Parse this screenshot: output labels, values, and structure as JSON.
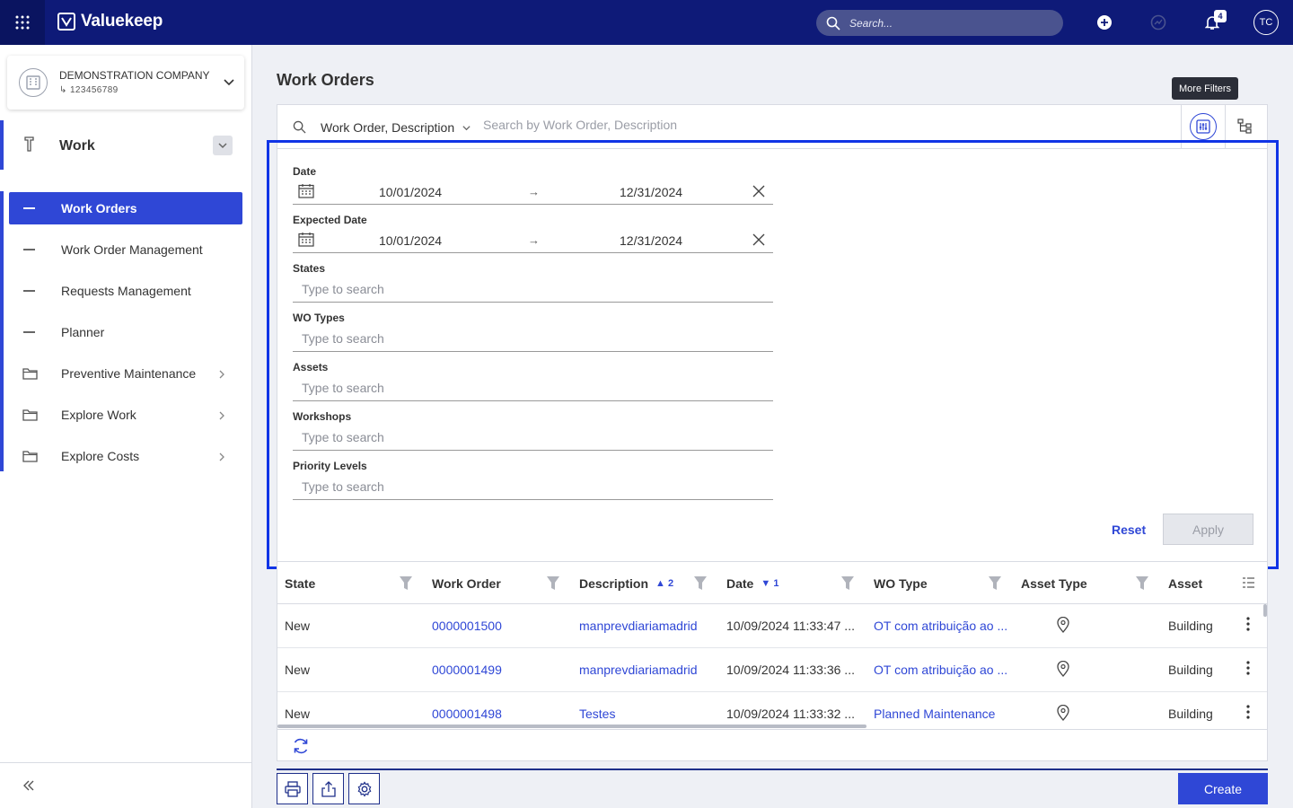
{
  "app": {
    "name": "Valuekeep",
    "search_placeholder": "Search...",
    "notification_count": "4",
    "user_initials": "TC"
  },
  "company": {
    "name": "DEMONSTRATION COMPANY",
    "code": "123456789"
  },
  "sidebar": {
    "section_title": "Work",
    "items": [
      {
        "label": "Work Orders",
        "type": "page",
        "active": true
      },
      {
        "label": "Work Order Management",
        "type": "page"
      },
      {
        "label": "Requests Management",
        "type": "page"
      },
      {
        "label": "Planner",
        "type": "page"
      },
      {
        "label": "Preventive Maintenance",
        "type": "folder"
      },
      {
        "label": "Explore Work",
        "type": "folder"
      },
      {
        "label": "Explore Costs",
        "type": "folder"
      }
    ]
  },
  "page": {
    "title": "Work Orders",
    "tooltip": "More Filters"
  },
  "searchbar": {
    "field": "Work Order, Description",
    "placeholder": "Search by Work Order, Description"
  },
  "filters": {
    "date": {
      "label": "Date",
      "from": "10/01/2024",
      "to": "12/31/2024"
    },
    "expected_date": {
      "label": "Expected Date",
      "from": "10/01/2024",
      "to": "12/31/2024"
    },
    "states": {
      "label": "States",
      "placeholder": "Type to search"
    },
    "wo_types": {
      "label": "WO Types",
      "placeholder": "Type to search"
    },
    "assets": {
      "label": "Assets",
      "placeholder": "Type to search"
    },
    "workshops": {
      "label": "Workshops",
      "placeholder": "Type to search"
    },
    "priority_levels": {
      "label": "Priority Levels",
      "placeholder": "Type to search"
    },
    "reset_label": "Reset",
    "apply_label": "Apply"
  },
  "table": {
    "columns": {
      "state": "State",
      "work_order": "Work Order",
      "description": "Description",
      "description_sort": "2",
      "date": "Date",
      "date_sort": "1",
      "wo_type": "WO Type",
      "asset_type": "Asset Type",
      "asset": "Asset"
    },
    "rows": [
      {
        "state": "New",
        "work_order": "0000001500",
        "description": "manprevdiariamadrid",
        "date": "10/09/2024 11:33:47 ...",
        "wo_type": "OT com atribuição ao ...",
        "asset": "Building"
      },
      {
        "state": "New",
        "work_order": "0000001499",
        "description": "manprevdiariamadrid",
        "date": "10/09/2024 11:33:36 ...",
        "wo_type": "OT com atribuição ao ...",
        "asset": "Building"
      },
      {
        "state": "New",
        "work_order": "0000001498",
        "description": "Testes",
        "date": "10/09/2024 11:33:32 ...",
        "wo_type": "Planned Maintenance",
        "asset": "Building"
      }
    ]
  },
  "actions": {
    "create_label": "Create"
  },
  "colors": {
    "topbar": "#0e1a78",
    "accent": "#2f47d6",
    "highlight": "#1034e6"
  }
}
